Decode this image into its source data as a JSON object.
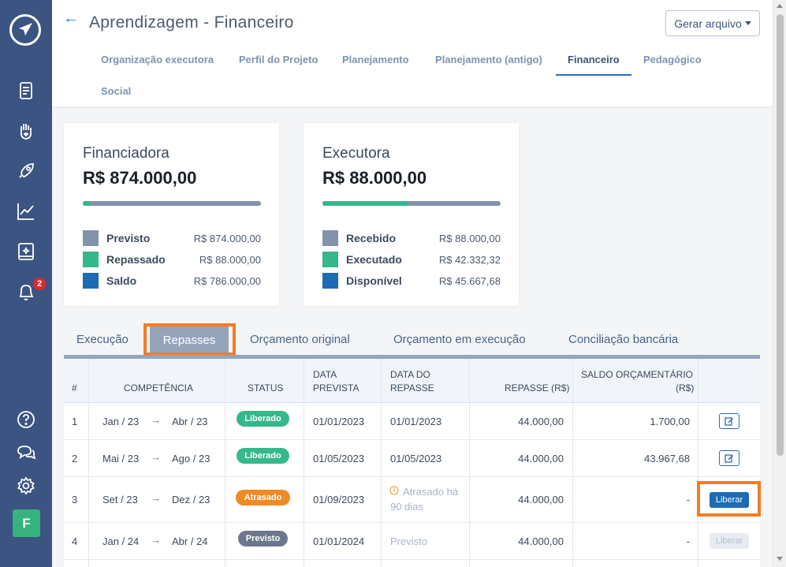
{
  "header": {
    "title": "Aprendizagem - Financeiro",
    "gerar_label": "Gerar arquivo",
    "tabs": [
      {
        "label": "Organização executora"
      },
      {
        "label": "Perfil do Projeto"
      },
      {
        "label": "Planejamento"
      },
      {
        "label": "Planejamento (antigo)"
      },
      {
        "label": "Financeiro",
        "active": true
      },
      {
        "label": "Pedagógico"
      },
      {
        "label": "Social"
      }
    ]
  },
  "sidebar": {
    "notification_count": "2",
    "avatar_initial": "F",
    "icons": [
      "document-icon",
      "hand-heart-icon",
      "rocket-icon",
      "chart-line-icon",
      "book-icon",
      "bell-icon",
      "help-icon",
      "chat-icon",
      "gear-icon"
    ]
  },
  "cards": [
    {
      "title": "Financiadora",
      "amount": "R$ 874.000,00",
      "bar_fill_fraction": 0.04,
      "rows": [
        {
          "label": "Previsto",
          "value": "R$ 874.000,00",
          "color": "#8592ab"
        },
        {
          "label": "Repassado",
          "value": "R$ 88.000,00",
          "color": "#35b88a"
        },
        {
          "label": "Saldo",
          "value": "R$ 786.000,00",
          "color": "#1c6bb4"
        }
      ]
    },
    {
      "title": "Executora",
      "amount": "R$ 88.000,00",
      "bar_fill_fraction": 0.48,
      "rows": [
        {
          "label": "Recebido",
          "value": "R$ 88.000,00",
          "color": "#8592ab"
        },
        {
          "label": "Executado",
          "value": "R$ 42.332,32",
          "color": "#35b88a"
        },
        {
          "label": "Disponível",
          "value": "R$ 45.667,68",
          "color": "#1c6bb4"
        }
      ]
    }
  ],
  "subtabs": [
    {
      "label": "Execução"
    },
    {
      "label": "Repasses",
      "active": true
    },
    {
      "label": "Orçamento original"
    },
    {
      "label": "Orçamento em execução"
    },
    {
      "label": "Conciliação bancária"
    }
  ],
  "table": {
    "headers": {
      "num": "#",
      "competencia": "COMPETÊNCIA",
      "status": "STATUS",
      "data_prevista_1": "DATA",
      "data_prevista_2": "PREVISTA",
      "data_repasse_1": "DATA DO",
      "data_repasse_2": "REPASSE",
      "repasse": "REPASSE (R$)",
      "saldo_1": "SALDO ORÇAMENTÁRIO",
      "saldo_2": "(R$)"
    },
    "rows": [
      {
        "num": "1",
        "from": "Jan / 23",
        "to": "Abr / 23",
        "status": "Liberado",
        "status_color": "#35b88a",
        "data_prevista": "01/01/2023",
        "data_repasse": "01/01/2023",
        "repasse": "44.000,00",
        "saldo": "1.700,00",
        "action": "edit"
      },
      {
        "num": "2",
        "from": "Mai / 23",
        "to": "Ago / 23",
        "status": "Liberado",
        "status_color": "#35b88a",
        "data_prevista": "01/05/2023",
        "data_repasse": "01/05/2023",
        "repasse": "44.000,00",
        "saldo": "43.967,68",
        "action": "edit"
      },
      {
        "num": "3",
        "from": "Set / 23",
        "to": "Dez / 23",
        "status": "Atrasado",
        "status_color": "#f08a24",
        "data_prevista": "01/09/2023",
        "data_repasse_1": "Atrasado há",
        "data_repasse_2": "90 dias",
        "repasse": "44.000,00",
        "saldo": "-",
        "action": "Liberar"
      },
      {
        "num": "4",
        "from": "Jan / 24",
        "to": "Abr / 24",
        "status": "Previsto",
        "status_color": "#6b778c",
        "data_prevista": "01/01/2024",
        "data_repasse": "Previsto",
        "repasse": "44.000,00",
        "saldo": "-",
        "action": "Liberar"
      }
    ]
  }
}
